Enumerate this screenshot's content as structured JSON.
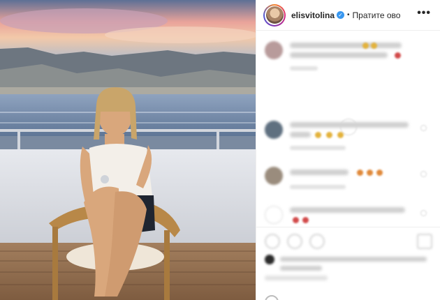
{
  "post": {
    "author": {
      "username": "elisvitolina",
      "verified": true,
      "follow_label": "Пратите ово",
      "separator": "•"
    },
    "more_label": "•••"
  },
  "colors": {
    "accent": "#3897f0",
    "text": "#262626",
    "border": "#efefef"
  },
  "icons": {
    "verified": "verified-badge-icon",
    "more": "more-options-icon",
    "load_more": "load-more-icon",
    "like": "heart-icon",
    "comment": "comment-icon",
    "share": "share-icon",
    "save": "bookmark-icon",
    "emoji": "emoji-icon"
  }
}
